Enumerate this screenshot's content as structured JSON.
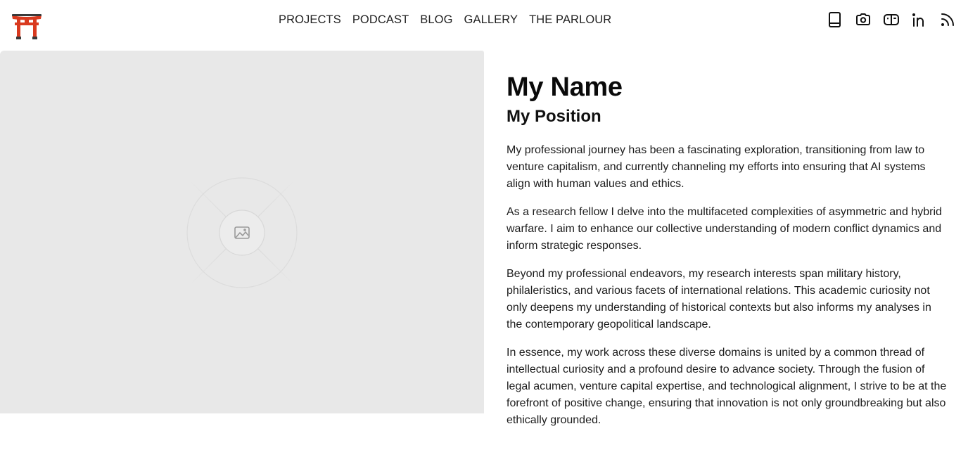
{
  "header": {
    "logo_icon": "torii-gate-icon",
    "nav": [
      "PROJECTS",
      "PODCAST",
      "BLOG",
      "GALLERY",
      "THE PARLOUR"
    ],
    "social_icons": [
      "book-icon",
      "camera-icon",
      "newsletter-icon",
      "linkedin-icon",
      "rss-icon"
    ]
  },
  "hero": {
    "image_icon": "image-placeholder-icon"
  },
  "profile": {
    "name": "My Name",
    "position": "My Position",
    "paragraphs": [
      "My professional journey has been a fascinating exploration, transitioning from law to venture capitalism, and currently channeling my efforts into ensuring that AI systems align with human values and ethics.",
      "As a research fellow I delve into the multifaceted complexities of asymmetric and hybrid warfare. I aim to enhance our collective understanding of modern conflict dynamics and inform strategic responses.",
      "Beyond my professional endeavors, my research interests span military history, philaleristics, and various facets of international relations. This academic curiosity not only deepens my understanding of historical contexts but also informs my analyses in the contemporary geopolitical landscape.",
      "In essence, my work across these diverse domains is united by a common thread of intellectual curiosity and a profound desire to advance society. Through the fusion of legal acumen, venture capital expertise, and technological alignment, I strive to be at the forefront of positive change, ensuring that innovation is not only groundbreaking but also ethically grounded."
    ]
  },
  "colors": {
    "torii_red": "#d93a1f",
    "placeholder_bg": "#e8e8e8",
    "text": "#111111"
  }
}
